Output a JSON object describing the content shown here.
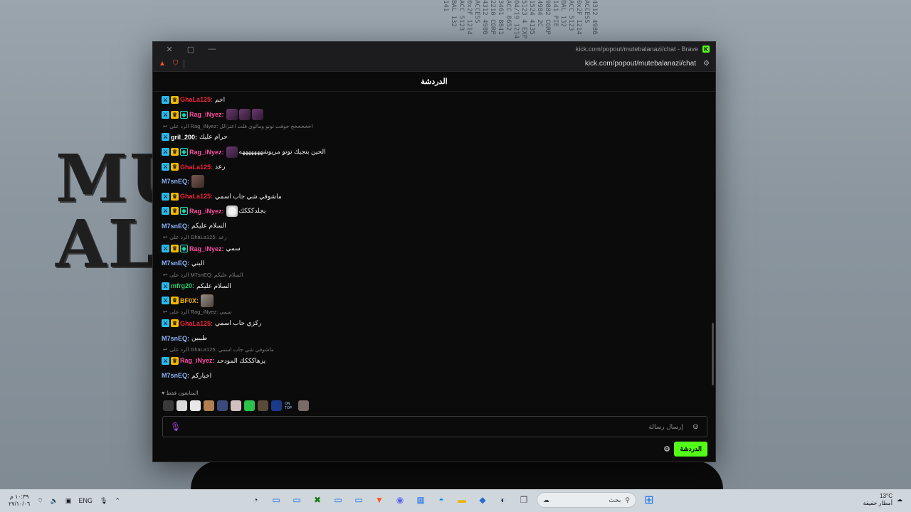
{
  "wallpaper": {
    "title_line1": "MU",
    "title_line2": "ALA"
  },
  "browser": {
    "title": "kick.com/popout/mutebalanazi/chat - Brave",
    "url": "kick.com/popout/mutebalanazi/chat"
  },
  "chat": {
    "header": "الدردشة",
    "messages": [
      {
        "type": "msg",
        "badges": [
          "mod",
          "vip"
        ],
        "user": "GhaLa125",
        "color": "#f1213a",
        "text": "احم"
      },
      {
        "type": "msg",
        "badges": [
          "mod",
          "vip",
          "sub"
        ],
        "user": "Rag_iNyez",
        "color": "#ff4fa3",
        "text": "",
        "emotes": 3
      },
      {
        "type": "reply",
        "text": "الرد على Rag_iNyez: اخخخخخخ خوفت توتو ومالوي قلت اعتزالل"
      },
      {
        "type": "msg",
        "badges": [
          "mod"
        ],
        "user": "gril_200",
        "color": "#ffffff",
        "text": "حرام عليك"
      },
      {
        "type": "msg",
        "badges": [
          "mod",
          "vip",
          "sub"
        ],
        "user": "Rag_iNyez",
        "color": "#ff4fa3",
        "text": "الحين بتجيك توتو مريوشهههههههه",
        "emotes": 1
      },
      {
        "type": "msg",
        "badges": [
          "mod",
          "vip"
        ],
        "user": "GhaLa125",
        "color": "#f1213a",
        "text": "رعد"
      },
      {
        "type": "msg",
        "badges": [],
        "user": "M7snEQ",
        "color": "#8ab4f8",
        "text": "",
        "cam": 1
      },
      {
        "type": "msg",
        "badges": [
          "mod",
          "vip"
        ],
        "user": "GhaLa125",
        "color": "#f1213a",
        "text": "ماشوفي شي جاب اسمي"
      },
      {
        "type": "msg",
        "badges": [
          "mod",
          "vip",
          "sub"
        ],
        "user": "Rag_iNyez",
        "color": "#ff4fa3",
        "text": "بجلدكككك",
        "cat": 1
      },
      {
        "type": "msg",
        "badges": [],
        "user": "M7snEQ",
        "color": "#8ab4f8",
        "text": "السلام عليكم"
      },
      {
        "type": "reply",
        "text": "الرد على GhaLa125: رعد"
      },
      {
        "type": "msg",
        "badges": [
          "mod",
          "vip",
          "sub"
        ],
        "user": "Rag_iNyez",
        "color": "#ff4fa3",
        "text": "سمي"
      },
      {
        "type": "msg",
        "badges": [],
        "user": "M7snEQ",
        "color": "#8ab4f8",
        "text": "البني"
      },
      {
        "type": "reply",
        "text": "الرد على M7snEQ: السلام عليكم"
      },
      {
        "type": "msg",
        "badges": [
          "mod"
        ],
        "user": "mfrg20",
        "color": "#2ecc71",
        "text": "السلام عليكم"
      },
      {
        "type": "msg",
        "badges": [
          "mod",
          "vip"
        ],
        "user": "BF0X",
        "color": "#f5b900",
        "text": "",
        "fox": 1
      },
      {
        "type": "reply",
        "text": "الرد على Rag_iNyez: سمي"
      },
      {
        "type": "msg",
        "badges": [
          "mod",
          "vip"
        ],
        "user": "GhaLa125",
        "color": "#f1213a",
        "text": "ركزي جاب اسمي"
      },
      {
        "type": "msg",
        "badges": [],
        "user": "M7snEQ",
        "color": "#8ab4f8",
        "text": "طيبين"
      },
      {
        "type": "reply",
        "text": "الرد على GhaLa125: ماشوفي شي جاب اسمي"
      },
      {
        "type": "msg",
        "badges": [
          "mod",
          "vip"
        ],
        "user": "Rag_iNyez",
        "color": "#ff4fa3",
        "text": "يزهاكككك المودحد"
      },
      {
        "type": "msg",
        "badges": [],
        "user": "M7snEQ",
        "color": "#8ab4f8",
        "text": "اخباركم"
      }
    ],
    "pinned_label": "المتابعون فقط",
    "emote_bar": [
      "emote-1",
      "emote-2",
      "emote-3",
      "emote-4",
      "emote-5",
      "emote-6",
      "emote-7",
      "emote-8",
      "emote-9",
      "ON TOP",
      "emote-11"
    ],
    "input_placeholder": "إرسال رسالة",
    "send_button": "الدردشة"
  },
  "taskbar": {
    "time": "١٠:٣٩ م",
    "date": "٢٧/١٠/٠٦",
    "lang": "ENG",
    "search_placeholder": "بحث",
    "weather_temp": "13°C",
    "weather_desc": "أمطار خفيفة"
  }
}
